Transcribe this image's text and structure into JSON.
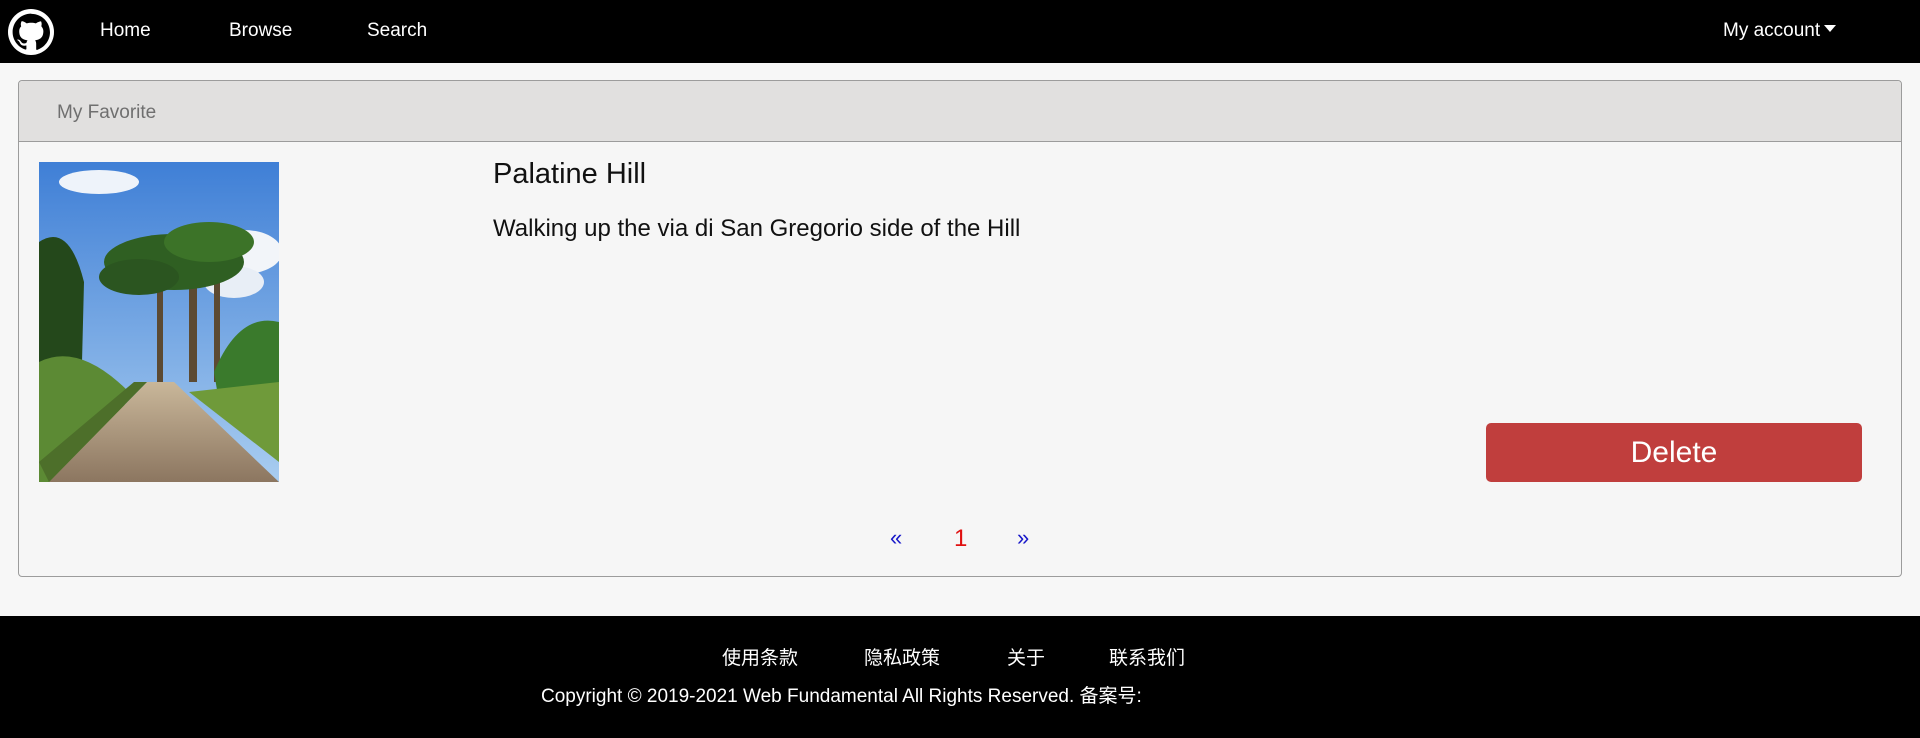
{
  "navbar": {
    "logo_icon": "github-octocat-icon",
    "links": [
      "Home",
      "Browse",
      "Search"
    ],
    "account_label": "My account"
  },
  "card": {
    "header": "My Favorite",
    "item": {
      "image_icon": "landscape-photo",
      "title": "Palatine Hill",
      "description": "Walking up the via di San Gregorio side of the Hill",
      "delete_label": "Delete"
    },
    "pagination": {
      "prev": "«",
      "current": "1",
      "next": "»"
    }
  },
  "footer": {
    "links": [
      "使用条款",
      "隐私政策",
      "关于",
      "联系我们"
    ],
    "copyright": "Copyright © 2019-2021 Web Fundamental All Rights Reserved. 备案号:"
  },
  "colors": {
    "navbar_bg": "#000000",
    "header_bg": "#e1e0df",
    "delete_btn": "#c03e3d",
    "page_link": "#1717c9",
    "page_current": "#e01010"
  }
}
